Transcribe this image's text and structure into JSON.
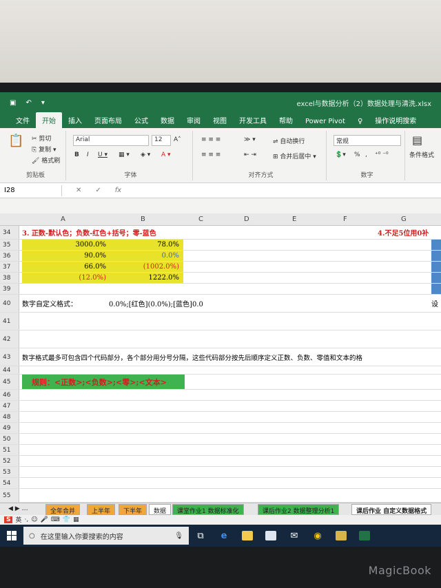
{
  "title_bar": {
    "document_title": "excel与数据分析（2）数据处理与清洗.xlsx"
  },
  "tabs": [
    "文件",
    "开始",
    "插入",
    "页面布局",
    "公式",
    "数据",
    "审阅",
    "视图",
    "开发工具",
    "帮助",
    "Power Pivot"
  ],
  "tell_me": "操作说明搜索",
  "ribbon": {
    "clipboard": {
      "cut": "剪切",
      "copy": "复制",
      "format_painter": "格式刷",
      "group_label": "剪贴板"
    },
    "font": {
      "name": "Arial",
      "size": "12",
      "group_label": "字体"
    },
    "alignment": {
      "wrap_text": "自动换行",
      "merge_center": "合并后居中",
      "group_label": "对齐方式"
    },
    "number": {
      "format": "常规",
      "percent": "%",
      "comma": ",",
      "group_label": "数字"
    },
    "styles": {
      "conditional_format": "条件格式"
    }
  },
  "name_box": "I28",
  "fx_label": "fx",
  "columns": [
    "A",
    "B",
    "C",
    "D",
    "E",
    "F",
    "G"
  ],
  "rows": {
    "r34": {
      "num": "34",
      "a": "3. 正数-默认色；负数-红色+括号；零-蓝色",
      "g": "4.不足5位用0补"
    },
    "r35": {
      "num": "35",
      "a": "3000.0%",
      "b": "78.0%"
    },
    "r36": {
      "num": "36",
      "a": "90.0%",
      "b": "0.0%"
    },
    "r37": {
      "num": "37",
      "a": "66.0%",
      "b": "(1002.0%)"
    },
    "r38": {
      "num": "38",
      "a": "(12.0%)",
      "b": "1222.0%"
    },
    "r39": {
      "num": "39"
    },
    "r40": {
      "num": "40",
      "a": "数字自定义格式：",
      "b": "0.0%;[红色](0.0%);[蓝色]0.0",
      "g": "设"
    },
    "r41": {
      "num": "41"
    },
    "r42": {
      "num": "42"
    },
    "r43": {
      "num": "43",
      "a": "数字格式最多可包含四个代码部分，各个部分用分号分隔，这些代码部分按先后顺序定义正数、负数、零值和文本的格"
    },
    "r44": {
      "num": "44"
    },
    "r45": {
      "num": "45",
      "a": "规则：<正数>;<负数>;<零>;<文本>"
    },
    "empty": [
      "46",
      "47",
      "48",
      "49",
      "50",
      "51",
      "52",
      "53",
      "54",
      "55"
    ]
  },
  "sheet_tabs": [
    "全年合并",
    "上半年",
    "下半年",
    "数据",
    "课堂作业1 数据标准化",
    "课后作业2 数据整理分析1",
    "课后作业 自定义数据格式"
  ],
  "taskbar": {
    "search_placeholder": "在这里输入你要搜索的内容"
  },
  "device_brand": "MagicBook",
  "colors": {
    "excel_green": "#217346",
    "highlight_yellow": "#e8e22a",
    "rule_green": "#3eb34f",
    "negative_red": "#d21f1f",
    "side_blue": "#4f88c6"
  }
}
